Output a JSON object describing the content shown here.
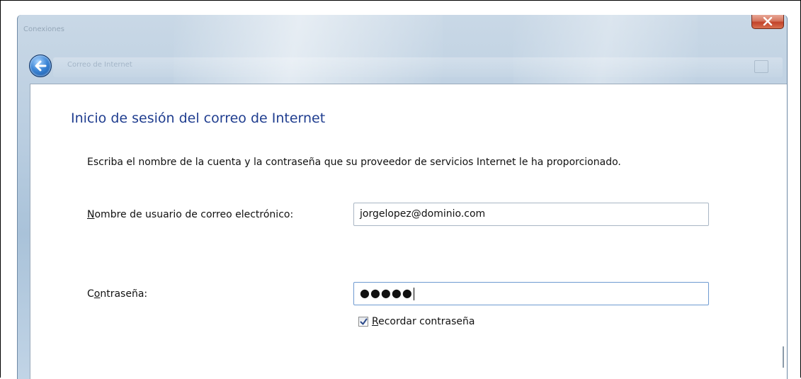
{
  "window": {
    "title_faded": "Conexiones",
    "address_faded": "Correo de Internet",
    "close_glyph": "x"
  },
  "page": {
    "title": "Inicio de sesión del correo de Internet",
    "instructions": "Escriba el nombre de la cuenta y la contraseña que su proveedor de servicios Internet le ha proporcionado."
  },
  "form": {
    "username_label_accel": "N",
    "username_label_rest": "ombre de usuario de correo electrónico:",
    "username_value": "jorgelopez@dominio.com",
    "password_label_pre": "C",
    "password_label_accel": "o",
    "password_label_rest": "ntraseña:",
    "password_value": "●●●●●",
    "remember_accel": "R",
    "remember_rest": "ecordar contraseña",
    "remember_checked": true
  },
  "icons": [
    "back-arrow-icon",
    "close-icon",
    "checkmark-icon"
  ],
  "colors": {
    "title_blue": "#1f3d8f",
    "close_red": "#c2432a",
    "back_blue": "#3d86d6"
  }
}
